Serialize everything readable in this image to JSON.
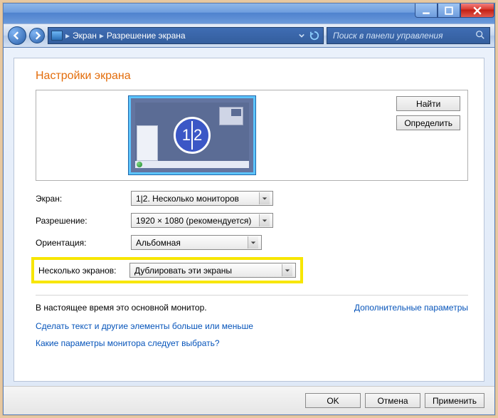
{
  "breadcrumb": {
    "item1": "Экран",
    "item2": "Разрешение экрана"
  },
  "search": {
    "placeholder": "Поиск в панели управления"
  },
  "page_title": "Настройки экрана",
  "buttons": {
    "find": "Найти",
    "detect": "Определить",
    "ok": "OK",
    "cancel": "Отмена",
    "apply": "Применить"
  },
  "monitor_badge": {
    "n1": "1",
    "n2": "2"
  },
  "labels": {
    "screen": "Экран:",
    "resolution": "Разрешение:",
    "orientation": "Ориентация:",
    "multiple": "Несколько экранов:"
  },
  "values": {
    "screen": "1|2. Несколько мониторов",
    "resolution": "1920 × 1080 (рекомендуется)",
    "orientation": "Альбомная",
    "multiple": "Дублировать эти экраны"
  },
  "info_text": "В настоящее время это основной монитор.",
  "links": {
    "advanced": "Дополнительные параметры",
    "text_size": "Сделать текст и другие элементы больше или меньше",
    "which_monitor": "Какие параметры монитора следует выбрать?"
  }
}
